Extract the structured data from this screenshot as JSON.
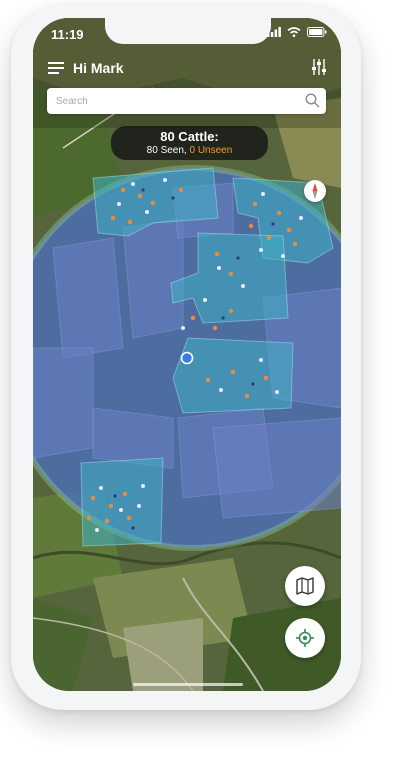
{
  "status_bar": {
    "time": "11:19"
  },
  "header": {
    "greeting": "Hi Mark"
  },
  "search": {
    "placeholder": "Search",
    "value": ""
  },
  "summary": {
    "count_label": "80 Cattle:",
    "seen_label": "80 Seen,",
    "unseen_label": "0 Unseen"
  },
  "colors": {
    "unseen_accent": "#f0a020",
    "location_dot": "#3b7de8",
    "field_highlight": "#3fb1c4",
    "coverage_area": "#4a6fc8"
  },
  "icons": {
    "menu": "menu-icon",
    "filter": "filter-sliders-icon",
    "search": "search-icon",
    "compass": "compass-icon",
    "map_layers": "map-icon",
    "locate": "locate-icon"
  }
}
